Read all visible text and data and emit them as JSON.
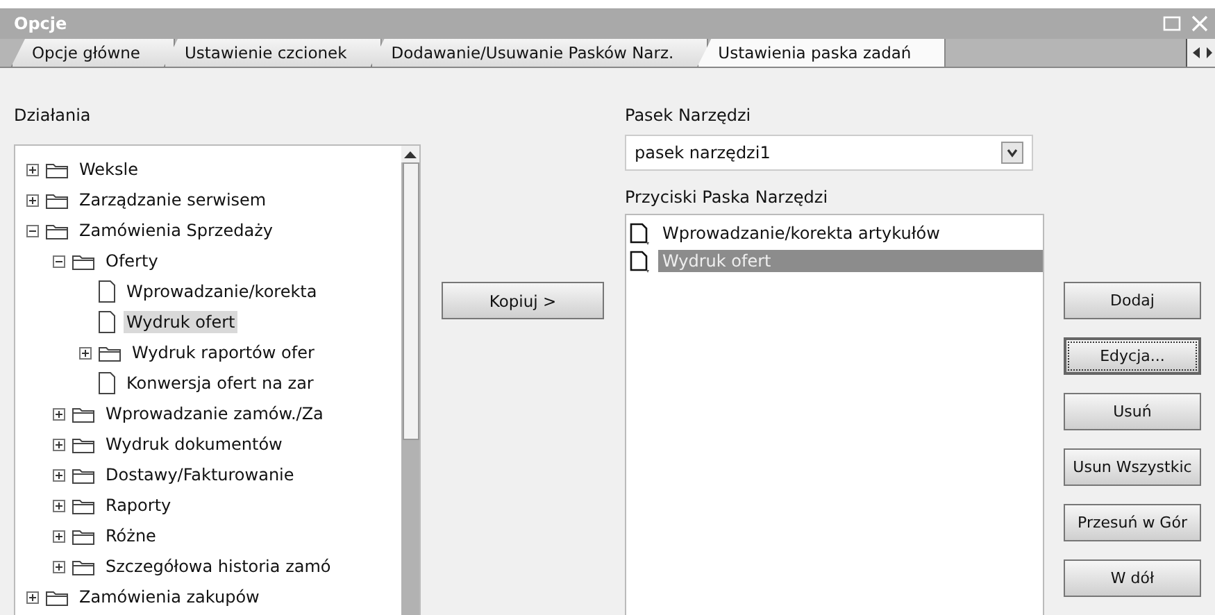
{
  "window": {
    "title": "Opcje"
  },
  "tabs": [
    {
      "label": "Opcje główne",
      "selected": false
    },
    {
      "label": "Ustawienie czcionek",
      "selected": false
    },
    {
      "label": "Dodawanie/Usuwanie Pasków Narz.",
      "selected": false
    },
    {
      "label": "Ustawienia paska zadań",
      "selected": true
    }
  ],
  "actions": {
    "label": "Działania",
    "tree": [
      {
        "kind": "folder",
        "label": "Weksle",
        "expanded": false,
        "selected": false
      },
      {
        "kind": "folder",
        "label": "Zarządzanie serwisem",
        "expanded": false,
        "selected": false
      },
      {
        "kind": "folder",
        "label": "Zamówienia Sprzedaży",
        "expanded": true,
        "selected": false,
        "children": [
          {
            "kind": "folder",
            "label": "Oferty",
            "expanded": true,
            "selected": false,
            "children": [
              {
                "kind": "file",
                "label": "Wprowadzanie/korekta",
                "selected": false
              },
              {
                "kind": "file",
                "label": "Wydruk ofert",
                "selected": true
              },
              {
                "kind": "folder",
                "label": "Wydruk raportów ofer",
                "expanded": false,
                "selected": false
              },
              {
                "kind": "file",
                "label": "Konwersja ofert na zar",
                "selected": false
              }
            ]
          },
          {
            "kind": "folder",
            "label": "Wprowadzanie zamów./Za",
            "expanded": false,
            "selected": false
          },
          {
            "kind": "folder",
            "label": "Wydruk dokumentów",
            "expanded": false,
            "selected": false
          },
          {
            "kind": "folder",
            "label": "Dostawy/Fakturowanie",
            "expanded": false,
            "selected": false
          },
          {
            "kind": "folder",
            "label": "Raporty",
            "expanded": false,
            "selected": false
          },
          {
            "kind": "folder",
            "label": "Różne",
            "expanded": false,
            "selected": false
          },
          {
            "kind": "folder",
            "label": "Szczegółowa historia zamó",
            "expanded": false,
            "selected": false
          }
        ]
      },
      {
        "kind": "folder",
        "label": "Zamówienia zakupów",
        "expanded": false,
        "selected": false
      }
    ]
  },
  "copy_button": "Kopiuj >",
  "toolbar": {
    "label": "Pasek Narzędzi",
    "value": "pasek narzędzi1"
  },
  "toolbar_buttons": {
    "label": "Przyciski Paska Narzędzi",
    "items": [
      {
        "label": "Wprowadzanie/korekta artykułów",
        "selected": false
      },
      {
        "label": "Wydruk ofert",
        "selected": true
      }
    ]
  },
  "buttons": [
    {
      "label": "Dodaj",
      "focused": false
    },
    {
      "label": "Edycja...",
      "focused": true
    },
    {
      "label": "Usuń",
      "focused": false
    },
    {
      "label": "Usun Wszystkic",
      "focused": false
    },
    {
      "label": "Przesuń w Gór",
      "focused": false
    },
    {
      "label": "W dół",
      "focused": false
    }
  ]
}
